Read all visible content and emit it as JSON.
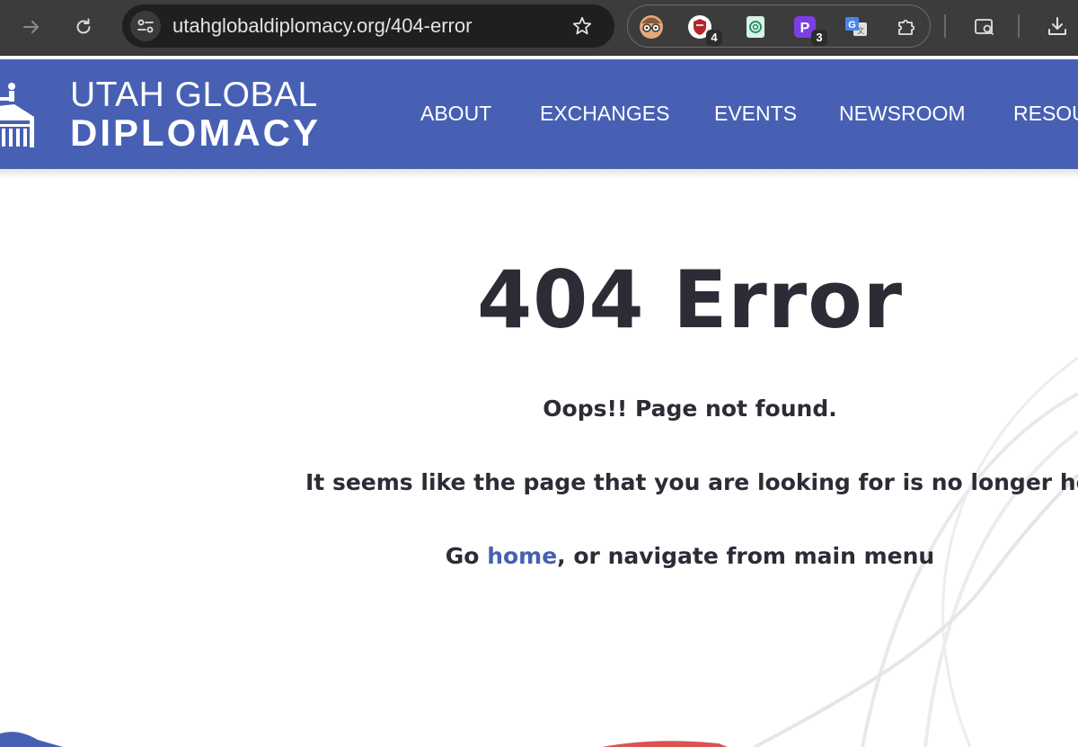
{
  "browser": {
    "url": "utahglobaldiplomacy.org/404-error",
    "extensions": [
      {
        "icon": "avatar-glasses-icon",
        "badge": ""
      },
      {
        "icon": "shield-extension-icon",
        "badge": "4"
      },
      {
        "icon": "chatgpt-extension-icon",
        "badge": ""
      },
      {
        "icon": "p-extension-icon",
        "badge": "3"
      },
      {
        "icon": "google-translate-icon",
        "badge": ""
      },
      {
        "icon": "puzzle-icon",
        "badge": ""
      }
    ]
  },
  "site": {
    "logo_line1": "UTAH GLOBAL",
    "logo_line2": "DIPLOMACY",
    "nav": [
      "ABOUT",
      "EXCHANGES",
      "EVENTS",
      "NEWSROOM",
      "RESOU"
    ]
  },
  "error": {
    "title": "404 Error",
    "line1": "Oops!! Page not found.",
    "line2": "It seems like the page that you are looking for is no longer here.",
    "line3_prefix": "Go ",
    "line3_link": "home",
    "line3_suffix": ", or navigate from main menu"
  },
  "colors": {
    "brand_blue": "#4760b4",
    "text_dark": "#2c2c36",
    "chrome_bg": "#3c3c3c",
    "accent_red": "#d9534f"
  }
}
